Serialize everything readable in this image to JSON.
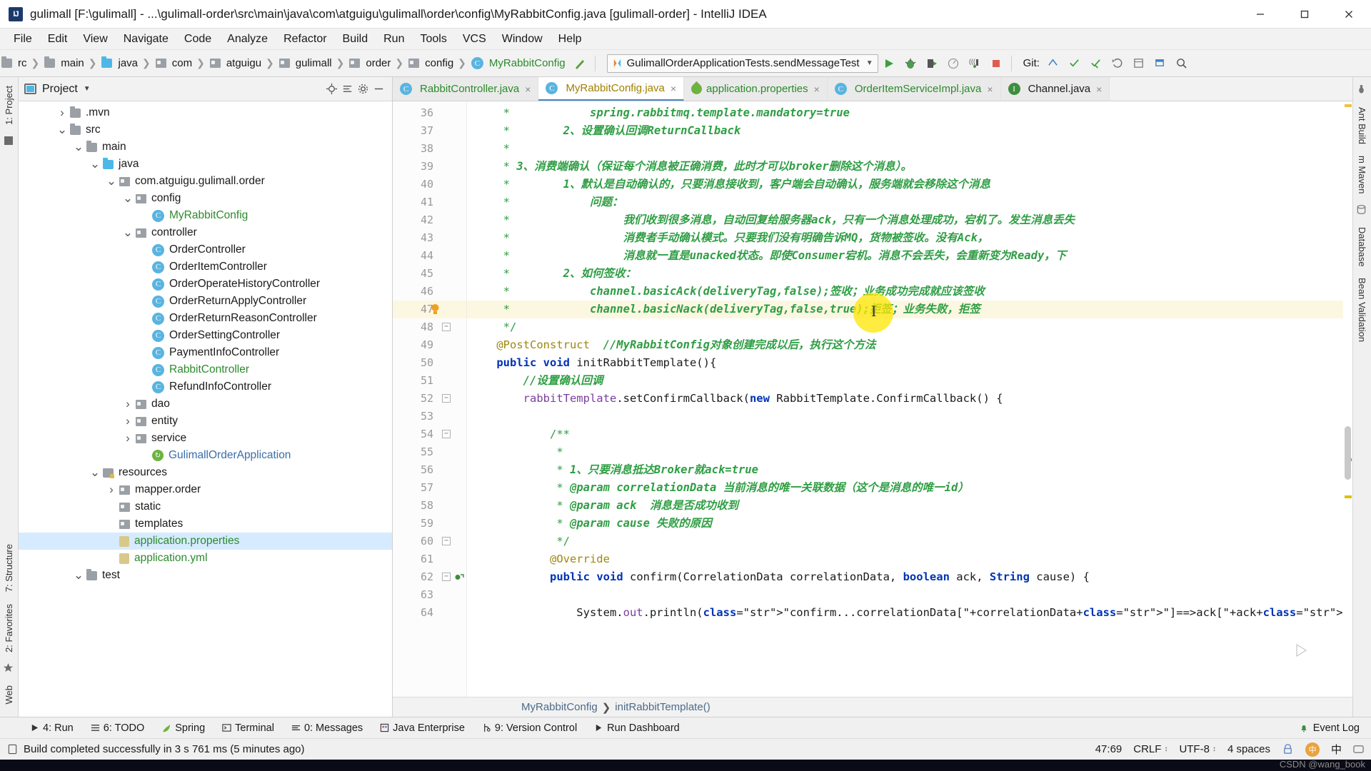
{
  "titlebar": {
    "app_icon": "intellij-logo-icon",
    "title": "gulimall [F:\\gulimall] - ...\\gulimall-order\\src\\main\\java\\com\\atguigu\\gulimall\\order\\config\\MyRabbitConfig.java [gulimall-order] - IntelliJ IDEA",
    "minimize": "minimize-icon",
    "maximize": "maximize-icon",
    "close": "close-icon"
  },
  "menubar": {
    "items": [
      "File",
      "Edit",
      "View",
      "Navigate",
      "Code",
      "Analyze",
      "Refactor",
      "Build",
      "Run",
      "Tools",
      "VCS",
      "Window",
      "Help"
    ]
  },
  "navbar": {
    "breadcrumbs": [
      {
        "label": "rc",
        "icon": "folder-grey-icon",
        "kind": "folder"
      },
      {
        "label": "main",
        "icon": "folder-grey-icon",
        "kind": "folder"
      },
      {
        "label": "java",
        "icon": "folder-blue-icon",
        "kind": "source-folder"
      },
      {
        "label": "com",
        "icon": "package-icon",
        "kind": "package"
      },
      {
        "label": "atguigu",
        "icon": "package-icon",
        "kind": "package"
      },
      {
        "label": "gulimall",
        "icon": "package-icon",
        "kind": "package"
      },
      {
        "label": "order",
        "icon": "package-icon",
        "kind": "package"
      },
      {
        "label": "config",
        "icon": "package-icon",
        "kind": "package"
      },
      {
        "label": "MyRabbitConfig",
        "icon": "class-icon",
        "kind": "class"
      }
    ],
    "run_config": "GulimallOrderApplicationTests.sendMessageTest",
    "run_config_caret": "chevron-down-icon",
    "buttons": [
      "run-icon",
      "debug-icon",
      "run-with-coverage-icon",
      "profile-icon",
      "run-tests-icon",
      "stop-icon"
    ],
    "git_label": "Git:",
    "git_buttons": [
      "update-project-icon",
      "commit-icon",
      "push-icon",
      "rollback-icon",
      "history-icon"
    ],
    "right_buttons": [
      "open-window-icon",
      "search-everywhere-icon"
    ]
  },
  "left_rail": {
    "items": [
      "1: Project",
      "7: Structure",
      "2: Favorites",
      "Web"
    ]
  },
  "right_rail": {
    "items": [
      "Ant Build",
      "m Maven",
      "Database",
      "Bean Validation"
    ]
  },
  "project_panel": {
    "title": "Project",
    "title_caret": "chevron-down-icon",
    "actions": [
      "locate-icon",
      "collapse-all-icon",
      "settings-icon",
      "hide-icon"
    ],
    "tree": [
      {
        "label": ".mvn",
        "indent": 2,
        "arrow": "collapsed",
        "icon": "folder-grey-icon",
        "style": "normal"
      },
      {
        "label": "src",
        "indent": 2,
        "arrow": "expanded",
        "icon": "folder-grey-icon",
        "style": "normal"
      },
      {
        "label": "main",
        "indent": 3,
        "arrow": "expanded",
        "icon": "folder-grey-icon",
        "style": "normal"
      },
      {
        "label": "java",
        "indent": 4,
        "arrow": "expanded",
        "icon": "folder-blue-icon",
        "style": "normal"
      },
      {
        "label": "com.atguigu.gulimall.order",
        "indent": 5,
        "arrow": "expanded",
        "icon": "package-icon",
        "style": "normal"
      },
      {
        "label": "config",
        "indent": 6,
        "arrow": "expanded",
        "icon": "package-icon",
        "style": "normal"
      },
      {
        "label": "MyRabbitConfig",
        "indent": 7,
        "arrow": "none",
        "icon": "class-icon",
        "style": "green"
      },
      {
        "label": "controller",
        "indent": 6,
        "arrow": "expanded",
        "icon": "package-icon",
        "style": "normal"
      },
      {
        "label": "OrderController",
        "indent": 7,
        "arrow": "none",
        "icon": "class-icon",
        "style": "normal"
      },
      {
        "label": "OrderItemController",
        "indent": 7,
        "arrow": "none",
        "icon": "class-icon",
        "style": "normal"
      },
      {
        "label": "OrderOperateHistoryController",
        "indent": 7,
        "arrow": "none",
        "icon": "class-icon",
        "style": "normal"
      },
      {
        "label": "OrderReturnApplyController",
        "indent": 7,
        "arrow": "none",
        "icon": "class-icon",
        "style": "normal"
      },
      {
        "label": "OrderReturnReasonController",
        "indent": 7,
        "arrow": "none",
        "icon": "class-icon",
        "style": "normal"
      },
      {
        "label": "OrderSettingController",
        "indent": 7,
        "arrow": "none",
        "icon": "class-icon",
        "style": "normal"
      },
      {
        "label": "PaymentInfoController",
        "indent": 7,
        "arrow": "none",
        "icon": "class-icon",
        "style": "normal"
      },
      {
        "label": "RabbitController",
        "indent": 7,
        "arrow": "none",
        "icon": "class-icon",
        "style": "green"
      },
      {
        "label": "RefundInfoController",
        "indent": 7,
        "arrow": "none",
        "icon": "class-icon",
        "style": "normal"
      },
      {
        "label": "dao",
        "indent": 6,
        "arrow": "collapsed",
        "icon": "package-icon",
        "style": "normal"
      },
      {
        "label": "entity",
        "indent": 6,
        "arrow": "collapsed",
        "icon": "package-icon",
        "style": "normal"
      },
      {
        "label": "service",
        "indent": 6,
        "arrow": "collapsed",
        "icon": "package-icon",
        "style": "normal"
      },
      {
        "label": "GulimallOrderApplication",
        "indent": 7,
        "arrow": "none",
        "icon": "spring-class-icon",
        "style": "blue"
      },
      {
        "label": "resources",
        "indent": 4,
        "arrow": "expanded",
        "icon": "resources-folder-icon",
        "style": "normal"
      },
      {
        "label": "mapper.order",
        "indent": 5,
        "arrow": "collapsed",
        "icon": "package-icon",
        "style": "normal"
      },
      {
        "label": "static",
        "indent": 5,
        "arrow": "none",
        "icon": "package-icon",
        "style": "normal"
      },
      {
        "label": "templates",
        "indent": 5,
        "arrow": "none",
        "icon": "package-icon",
        "style": "normal"
      },
      {
        "label": "application.properties",
        "indent": 5,
        "arrow": "none",
        "icon": "properties-icon",
        "style": "green",
        "selected": true
      },
      {
        "label": "application.yml",
        "indent": 5,
        "arrow": "none",
        "icon": "properties-icon",
        "style": "green"
      },
      {
        "label": "test",
        "indent": 3,
        "arrow": "expanded",
        "icon": "folder-grey-icon",
        "style": "normal"
      }
    ]
  },
  "editor": {
    "tabs": [
      {
        "label": "RabbitController.java",
        "icon": "class-icon",
        "color": "green",
        "active": false
      },
      {
        "label": "MyRabbitConfig.java",
        "icon": "class-icon",
        "color": "gold",
        "active": true
      },
      {
        "label": "application.properties",
        "icon": "spring-leaf-icon",
        "color": "green",
        "active": false
      },
      {
        "label": "OrderItemServiceImpl.java",
        "icon": "class-icon",
        "color": "green",
        "active": false
      },
      {
        "label": "Channel.java",
        "icon": "interface-icon",
        "color": "normal",
        "active": false
      }
    ],
    "first_line_number": 36,
    "lines": [
      {
        "n": 36,
        "text": "     *            spring.rabbitmq.template.mandatory=true",
        "kind": "comment-italic"
      },
      {
        "n": 37,
        "text": "     *        2、设置确认回调ReturnCallback",
        "kind": "comment"
      },
      {
        "n": 38,
        "text": "     *",
        "kind": "comment"
      },
      {
        "n": 39,
        "text": "     * 3、消费端确认（保证每个消息被正确消费，此时才可以broker删除这个消息）。",
        "kind": "comment"
      },
      {
        "n": 40,
        "text": "     *        1、默认是自动确认的，只要消息接收到，客户端会自动确认，服务端就会移除这个消息",
        "kind": "comment"
      },
      {
        "n": 41,
        "text": "     *            问题：",
        "kind": "comment"
      },
      {
        "n": 42,
        "text": "     *                 我们收到很多消息，自动回复给服务器ack，只有一个消息处理成功，宕机了。发生消息丢失",
        "kind": "comment"
      },
      {
        "n": 43,
        "text": "     *                 消费者手动确认模式。只要我们没有明确告诉MQ，货物被签收。没有Ack，",
        "kind": "comment"
      },
      {
        "n": 44,
        "text": "     *                 消息就一直是unacked状态。即使Consumer宕机。消息不会丢失，会重新变为Ready，下",
        "kind": "comment"
      },
      {
        "n": 45,
        "text": "     *        2、如何签收：",
        "kind": "comment"
      },
      {
        "n": 46,
        "text": "     *            channel.basicAck(deliveryTag,false);签收；业务成功完成就应该签收",
        "kind": "comment"
      },
      {
        "n": 47,
        "text": "     *            channel.basicNack(deliveryTag,false,true);拒签；业务失败，拒签",
        "kind": "comment",
        "highlight": true,
        "bulb": true
      },
      {
        "n": 48,
        "text": "     */",
        "kind": "comment",
        "fold": true
      },
      {
        "n": 49,
        "text": "    @PostConstruct  //MyRabbitConfig对象创建完成以后，执行这个方法",
        "kind": "annotation-line"
      },
      {
        "n": 50,
        "text": "    public void initRabbitTemplate(){",
        "kind": "code"
      },
      {
        "n": 51,
        "text": "        //设置确认回调",
        "kind": "line-comment"
      },
      {
        "n": 52,
        "text": "        rabbitTemplate.setConfirmCallback(new RabbitTemplate.ConfirmCallback() {",
        "kind": "code",
        "fold": true
      },
      {
        "n": 53,
        "text": "",
        "kind": "code"
      },
      {
        "n": 54,
        "text": "            /**",
        "kind": "comment",
        "fold": true
      },
      {
        "n": 55,
        "text": "             *",
        "kind": "comment"
      },
      {
        "n": 56,
        "text": "             * 1、只要消息抵达Broker就ack=true",
        "kind": "comment"
      },
      {
        "n": 57,
        "text": "             * @param correlationData 当前消息的唯一关联数据（这个是消息的唯一id）",
        "kind": "comment"
      },
      {
        "n": 58,
        "text": "             * @param ack  消息是否成功收到",
        "kind": "comment"
      },
      {
        "n": 59,
        "text": "             * @param cause 失败的原因",
        "kind": "comment"
      },
      {
        "n": 60,
        "text": "             */",
        "kind": "comment",
        "fold": true
      },
      {
        "n": 61,
        "text": "            @Override",
        "kind": "annotation-line"
      },
      {
        "n": 62,
        "text": "            public void confirm(CorrelationData correlationData, boolean ack, String cause) {",
        "kind": "code",
        "fold": true,
        "runmark": true
      },
      {
        "n": 63,
        "text": "",
        "kind": "code"
      },
      {
        "n": 64,
        "text": "                System.out.println(\"confirm...correlationData[\"+correlationData+\"]==>ack[\"+ack+\"]\");",
        "kind": "code"
      }
    ],
    "bottom_breadcrumb": [
      "MyRabbitConfig",
      "initRabbitTemplate()"
    ]
  },
  "toolwindows": {
    "items": [
      {
        "icon": "run-icon",
        "label": "4: Run"
      },
      {
        "icon": "todo-icon",
        "label": "6: TODO"
      },
      {
        "icon": "spring-icon",
        "label": "Spring"
      },
      {
        "icon": "terminal-icon",
        "label": "Terminal"
      },
      {
        "icon": "messages-icon",
        "label": "0: Messages"
      },
      {
        "icon": "java-ee-icon",
        "label": "Java Enterprise"
      },
      {
        "icon": "vcs-icon",
        "label": "9: Version Control"
      },
      {
        "icon": "dashboard-icon",
        "label": "Run Dashboard"
      }
    ],
    "event_log": "Event Log",
    "event_log_icon": "bell-icon"
  },
  "statusbar": {
    "message_icon": "build-icon",
    "message": "Build completed successfully in 3 s 761 ms (5 minutes ago)",
    "caret_position": "47:69",
    "line_separator": "CRLF",
    "encoding": "UTF-8",
    "indent": "4 spaces",
    "ime_icon": "ime-icon",
    "ime_label": "中",
    "lock_icon": "lock-icon"
  },
  "watermark": "CSDN @wang_book",
  "colors": {
    "accent_blue": "#4a88c7",
    "selection": "#d6ebff",
    "comment_green": "#2f9e44",
    "keyword_blue": "#0033b3",
    "annotation_gold": "#9e880d",
    "highlight_line": "#fcf7e1",
    "cursor_ring": "#ffe600"
  }
}
